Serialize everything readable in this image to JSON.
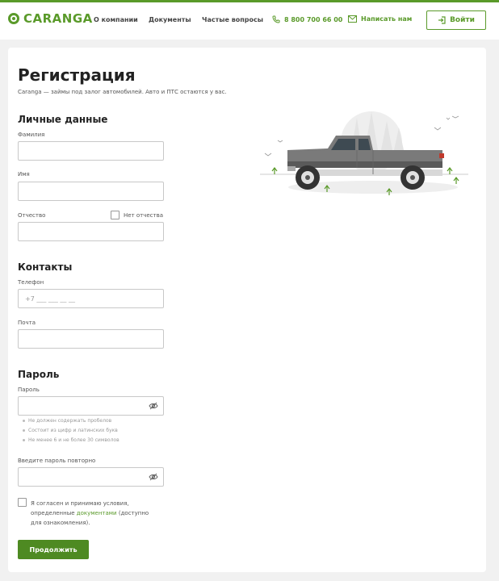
{
  "header": {
    "logo_text": "CARANGA",
    "nav": [
      "О компании",
      "Документы",
      "Частые вопросы"
    ],
    "phone": "8 800 700 66 00",
    "write_us": "Написать нам",
    "login": "Войти"
  },
  "page": {
    "title": "Регистрация",
    "subtitle": "Caranga — займы под залог автомобилей. Авто и ПТС остаются у вас."
  },
  "personal": {
    "section": "Личные данные",
    "lastname_label": "Фамилия",
    "firstname_label": "Имя",
    "patronymic_label": "Отчество",
    "no_patronymic": "Нет отчества"
  },
  "contacts": {
    "section": "Контакты",
    "phone_label": "Телефон",
    "phone_placeholder": "+7 ___ ___ __ __",
    "email_label": "Почта"
  },
  "password": {
    "section": "Пароль",
    "password_label": "Пароль",
    "hints": [
      "Не должен содержать пробелов",
      "Состоит из цифр и латинских букв",
      "Не менее 6 и не более 30 символов"
    ],
    "repeat_label": "Введите пароль повторно"
  },
  "agreement": {
    "text_before": "Я согласен и принимаю условия, определенные ",
    "link": "документами",
    "text_after": " (доступно для ознакомления)."
  },
  "submit": "Продолжить",
  "colors": {
    "accent": "#5a9a2a",
    "button": "#4e8a22"
  }
}
